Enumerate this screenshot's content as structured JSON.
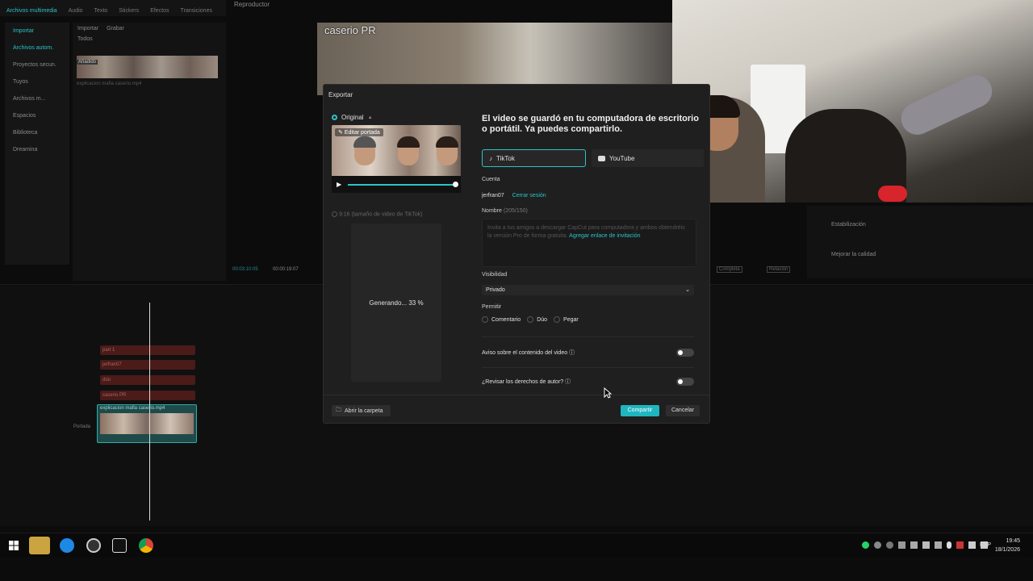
{
  "app": {
    "tabs": [
      "Archivos multimedia",
      "Audio",
      "Texto",
      "Stickers",
      "Efectos",
      "Transiciones"
    ],
    "player_label": "Reproductor",
    "nav": [
      "Importar",
      "Archivos autom.",
      "Proyectos secun.",
      "Tuyos",
      "Archivos m...",
      "Espacios",
      "Biblioteca",
      "Dreamina"
    ],
    "media_toolbar": [
      "Importar",
      "Grabar"
    ],
    "media_filter": "Todos",
    "media_badge": "Añadido",
    "media_filename": "explicacion mafia caserio.mp4",
    "timecode_current": "00:03:10:05",
    "timecode_total": "00:00:19:07",
    "tracks": [
      "part 1",
      "jerfran07",
      "dúo",
      "caserio PR"
    ],
    "video_clip_name": "explicacion mafia caserio.mp4",
    "cover_label": "Portada",
    "right_items": [
      "Estabilización",
      "Mejorar la calidad"
    ],
    "right_tags": [
      "Completa",
      "Relación"
    ]
  },
  "bg_video_title": "caserio PR",
  "dialog": {
    "title": "Exportar",
    "original_label": "Original",
    "edit_cover": "Editar portada",
    "tiktok_option": "9:16 (tamaño de video de TikTok)",
    "generating": "Generando... 33 %",
    "headline": "El video se guardó en tu computadora de escritorio o portátil. Ya puedes compartirlo.",
    "platforms": [
      "TikTok",
      "YouTube"
    ],
    "account_label": "Cuenta",
    "account_name": "jerfran07",
    "logout": "Cerrar sesión",
    "name_label": "Nombre",
    "name_count": "(205/150)",
    "name_text": "Invita a tus amigos a descargar CapCut para computadora y ambos obtendréis la versión Pro de forma gratuita.",
    "name_link": "Agregar enlace de invitación",
    "visibility_label": "Visibilidad",
    "visibility_value": "Privado",
    "allow_label": "Permitir",
    "allow_options": [
      "Comentario",
      "Dúo",
      "Pegar"
    ],
    "content_notice": "Aviso sobre el contenido del video",
    "copyright_check": "¿Revisar los derechos de autor?",
    "open_folder": "Abrir la carpeta",
    "share": "Compartir",
    "cancel": "Cancelar",
    "progress": 0.33
  },
  "taskbar": {
    "lang": "ESP",
    "time": "19:45",
    "date": "18/1/2026"
  },
  "colors": {
    "accent": "#1fb6c0",
    "track": "#4a1b18"
  }
}
